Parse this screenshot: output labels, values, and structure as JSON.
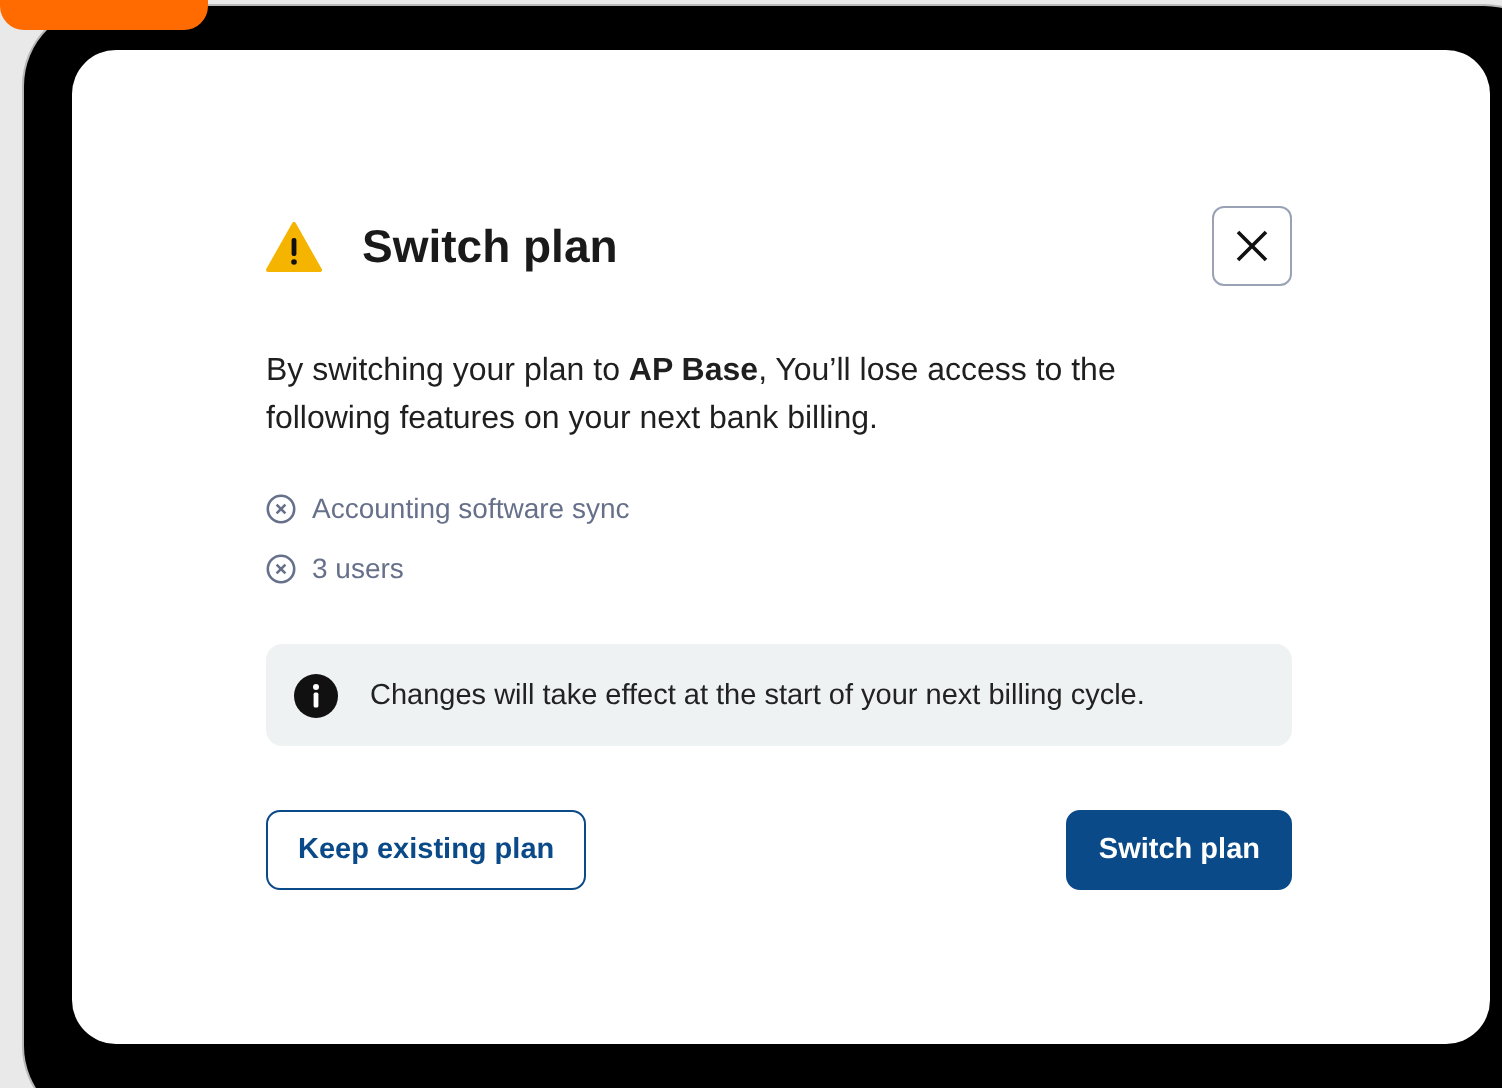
{
  "dialog": {
    "title": "Switch plan",
    "message": "By switching your plan to **AP Base**, You’ll lose access to the following features on your next bank billing.",
    "lost_features": [
      "Accounting software sync",
      "3 users"
    ],
    "notice": "Changes will take effect at the start of your next billing cycle.",
    "buttons": [
      {
        "label": "Keep existing plan",
        "kind": "secondary"
      },
      {
        "label": "Switch plan",
        "kind": "primary"
      }
    ]
  }
}
